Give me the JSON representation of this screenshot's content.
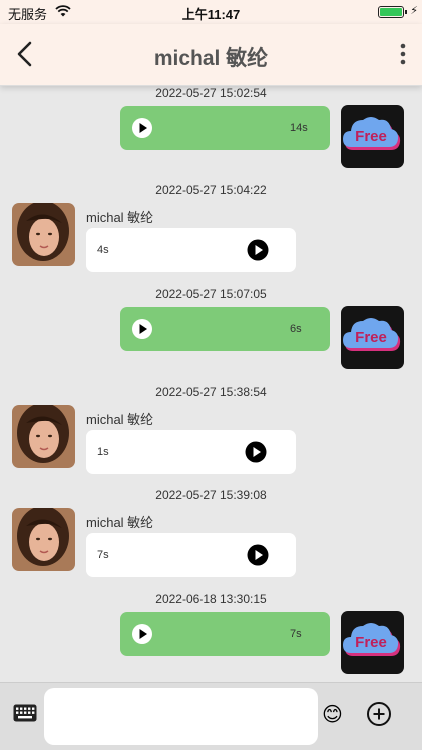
{
  "status_bar": {
    "carrier": "无服务",
    "time": "上午11:47",
    "wifi_icon": "wifi-icon",
    "battery_icon": "battery-icon",
    "charging_icon": "bolt-icon"
  },
  "header": {
    "title": "michal 敏纶",
    "back_icon": "chevron-left-icon",
    "more_icon": "more-vertical-icon"
  },
  "messages": [
    {
      "direction": "outgoing",
      "timestamp": "2022-05-27 15:02:54",
      "type": "voice",
      "duration": "14s",
      "avatar_text": "Free"
    },
    {
      "direction": "incoming",
      "timestamp": "2022-05-27 15:04:22",
      "sender": "michal  敏纶",
      "type": "voice",
      "duration": "4s"
    },
    {
      "direction": "outgoing",
      "timestamp": "2022-05-27 15:07:05",
      "type": "voice",
      "duration": "6s",
      "avatar_text": "Free"
    },
    {
      "direction": "incoming",
      "timestamp": "2022-05-27 15:38:54",
      "sender": "michal  敏纶",
      "type": "voice",
      "duration": "1s"
    },
    {
      "direction": "incoming",
      "timestamp": "2022-05-27 15:39:08",
      "sender": "michal  敏纶",
      "type": "voice",
      "duration": "7s"
    },
    {
      "direction": "outgoing",
      "timestamp": "2022-06-18 13:30:15",
      "type": "voice",
      "duration": "7s",
      "avatar_text": "Free"
    }
  ],
  "input_bar": {
    "keyboard_icon": "keyboard-icon",
    "placeholder": "",
    "emoji": "😊",
    "plus_icon": "plus-circle-icon"
  },
  "colors": {
    "header_bg": "#fdf1ea",
    "outgoing_bubble": "#7ecb78",
    "incoming_bubble": "#ffffff",
    "chat_bg": "#e8e8e8"
  }
}
